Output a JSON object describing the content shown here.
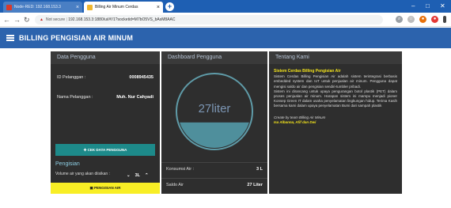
{
  "browser": {
    "tabs": [
      {
        "label": "Node-RED: 192.168.153.3"
      },
      {
        "label": "Billing Air Minum Cerdas"
      }
    ],
    "new_tab_symbol": "+",
    "address": {
      "security_label": "Not secure",
      "url": "192.168.153.3:1880/ui/#!/1?socketid=M7bO5VS_bAsM8AAC"
    },
    "window_controls": {
      "minimize": "–",
      "maximize": "□",
      "close": "✕"
    }
  },
  "app": {
    "title": "BILLING PENGISIAN AIR MINUM"
  },
  "data_pengguna": {
    "header": "Data Pengguna",
    "id_label": "ID Pelanggan :",
    "id_value": "0008945435",
    "nama_label": "Nama Pelanggan :",
    "nama_value": "Muh. Nur Cahyadi",
    "cek_button_label": "CEK DATA PENGGUNA"
  },
  "pengisian": {
    "header": "Pengisian",
    "volume_label": "Volume air yang akan diisikan :",
    "volume_value": "3L",
    "decrement": "⌄",
    "increment": "⌃",
    "isi_button_label": "PENGISIAN AIR"
  },
  "dashboard": {
    "header": "Dashboard Pengguna",
    "gauge_value": "27liter",
    "gauge_level": 0.35,
    "konsumsi_label": "Konsumsi Air :",
    "konsumsi_value": "3 L",
    "saldo_label": "Saldo Air",
    "saldo_value": "27 Liter"
  },
  "tentang": {
    "header": "Tentang Kami",
    "title": "Sistem Cerdas Billing Pengisian Air",
    "paragraph1": "Sistem Cerdas Billing Pengisian Air adalah sistem terintegrasi berbasis embedded system dan IoT untuk penjualan air minum. Pengguna dapat mengisi saldo air dan pengisian sendiri-tumbler pribadi.",
    "paragraph2": "Sistem ini dirancang untuk upaya pengurangan botol plastik (PET) dalam proses penjualan air minum. Harapan sistem ini mampu menjadi pioner Konsep Green IT dalam usaha penyelamatan lingkungan hidup. Terima Kasih bersama kami dalam upaya penyelamatan Bumi dari sampah plastik",
    "credit": "Create by team Billing Air Minum",
    "authors": "Isa Albanna, Afif dan Dwi"
  },
  "colors": {
    "appbar": "#2c63ad",
    "card": "#2e2e2e",
    "cek_button": "#1d8a8a",
    "isi_button": "#f8ee25",
    "accent_text": "#f4e41c"
  }
}
